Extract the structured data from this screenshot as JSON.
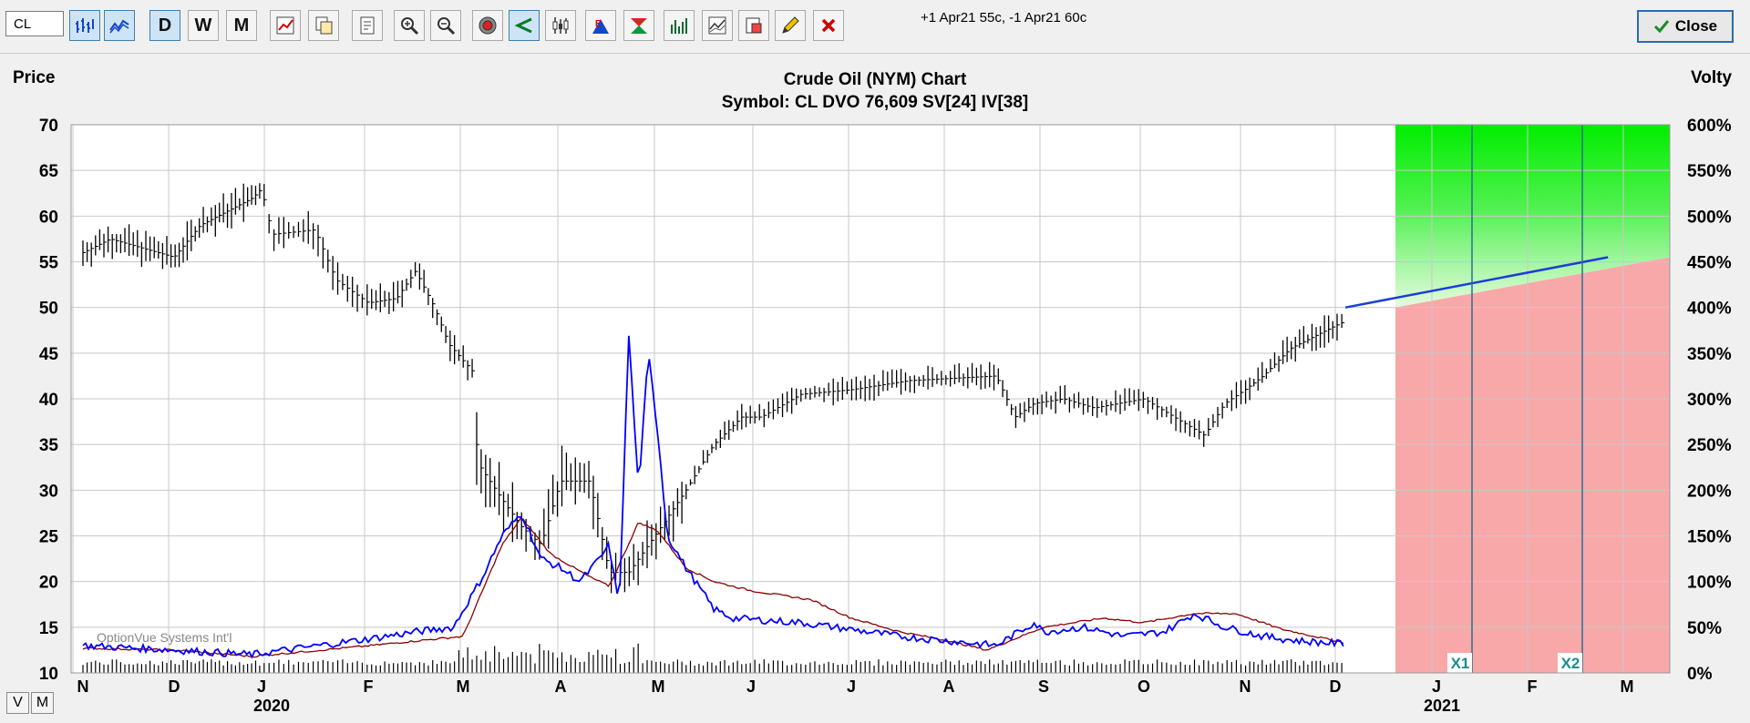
{
  "toolbar": {
    "symbol_value": "CL",
    "status_text": "+1 Apr21 55c, -1 Apr21 60c",
    "period_day": "D",
    "period_week": "W",
    "period_month": "M",
    "close_label": "Close",
    "accent": "#2a6cb3"
  },
  "bottom": {
    "v_label": "V",
    "m_label": "M"
  },
  "chart_data": {
    "type": "bar",
    "subtype": "ohlc-price-volatility",
    "title": "Crude Oil (NYM) Chart",
    "subtitle": "Symbol: CL  DVO 76,609  SV[24]  IV[38]",
    "ylabel": "Price",
    "y2label": "Volty",
    "ylim": [
      10,
      70
    ],
    "y2lim": [
      0,
      600
    ],
    "yticks": [
      "70",
      "65",
      "60",
      "55",
      "50",
      "45",
      "40",
      "35",
      "30",
      "25",
      "20",
      "15",
      "10"
    ],
    "y2ticks": [
      "600%",
      "550%",
      "500%",
      "450%",
      "400%",
      "350%",
      "300%",
      "250%",
      "200%",
      "150%",
      "100%",
      "50%",
      "0%"
    ],
    "month_labels": [
      "N",
      "D",
      "J",
      "F",
      "M",
      "A",
      "M",
      "J",
      "J",
      "A",
      "S",
      "O",
      "N",
      "D",
      "J",
      "F",
      "M"
    ],
    "year_labels": [
      "2020",
      "2021"
    ],
    "watermark": "OptionVue Systems Int'l",
    "markers": [
      "X1",
      "X2"
    ],
    "grid": true,
    "colors": {
      "price": "#000000",
      "implied_vol": "#0000ff",
      "stat_vol": "#8b0000",
      "profit_zone": "#00ee00",
      "loss_zone": "#f8a8a8",
      "projection": "#1c3ed6"
    },
    "price_anchors": [
      [
        0,
        56
      ],
      [
        0.3,
        57.5
      ],
      [
        1.0,
        55.5
      ],
      [
        1.3,
        59
      ],
      [
        1.7,
        61
      ],
      [
        1.9,
        62
      ],
      [
        2.0,
        63
      ],
      [
        2.1,
        58
      ],
      [
        2.5,
        58.5
      ],
      [
        2.7,
        53
      ],
      [
        3.0,
        50.5
      ],
      [
        3.3,
        51
      ],
      [
        3.5,
        54
      ],
      [
        3.7,
        50
      ],
      [
        3.85,
        46
      ],
      [
        4.1,
        43
      ],
      [
        4.15,
        33
      ],
      [
        4.4,
        29
      ],
      [
        4.6,
        26
      ],
      [
        4.8,
        24
      ],
      [
        5.0,
        31
      ],
      [
        5.3,
        31
      ],
      [
        5.5,
        21
      ],
      [
        5.7,
        21
      ],
      [
        5.9,
        24
      ],
      [
        6.1,
        27
      ],
      [
        6.3,
        30
      ],
      [
        6.6,
        35
      ],
      [
        6.9,
        38
      ],
      [
        7.1,
        38
      ],
      [
        7.5,
        40.5
      ],
      [
        8.0,
        41
      ],
      [
        8.6,
        42
      ],
      [
        9.5,
        42.5
      ],
      [
        9.7,
        38
      ],
      [
        9.9,
        39.5
      ],
      [
        10.2,
        40
      ],
      [
        10.5,
        39
      ],
      [
        11.0,
        40
      ],
      [
        11.6,
        36
      ],
      [
        11.8,
        39.5
      ],
      [
        12.2,
        42.5
      ],
      [
        12.5,
        45.5
      ],
      [
        13.1,
        48.5
      ]
    ],
    "stat_vol_anchors": [
      [
        0,
        27
      ],
      [
        1.0,
        25
      ],
      [
        1.9,
        18
      ],
      [
        3.5,
        35
      ],
      [
        4.0,
        40
      ],
      [
        4.4,
        140
      ],
      [
        4.6,
        170
      ],
      [
        4.9,
        130
      ],
      [
        5.3,
        105
      ],
      [
        5.5,
        95
      ],
      [
        5.8,
        165
      ],
      [
        6.0,
        155
      ],
      [
        6.3,
        115
      ],
      [
        6.6,
        100
      ],
      [
        7.0,
        90
      ],
      [
        7.3,
        85
      ],
      [
        7.6,
        80
      ],
      [
        8.0,
        60
      ],
      [
        8.5,
        45
      ],
      [
        9.0,
        35
      ],
      [
        9.4,
        25
      ],
      [
        10.0,
        50
      ],
      [
        10.6,
        60
      ],
      [
        11.0,
        55
      ],
      [
        11.5,
        65
      ],
      [
        11.9,
        65
      ],
      [
        12.4,
        48
      ],
      [
        13.1,
        33
      ]
    ],
    "implied_vol_anchors": [
      [
        0,
        30
      ],
      [
        1.0,
        25
      ],
      [
        1.9,
        20
      ],
      [
        3.5,
        45
      ],
      [
        3.9,
        50
      ],
      [
        4.2,
        105
      ],
      [
        4.4,
        150
      ],
      [
        4.6,
        175
      ],
      [
        4.8,
        125
      ],
      [
        5.0,
        115
      ],
      [
        5.2,
        100
      ],
      [
        5.4,
        125
      ],
      [
        5.5,
        140
      ],
      [
        5.6,
        70
      ],
      [
        5.7,
        370
      ],
      [
        5.8,
        200
      ],
      [
        5.9,
        350
      ],
      [
        6.0,
        260
      ],
      [
        6.1,
        150
      ],
      [
        6.3,
        115
      ],
      [
        6.6,
        70
      ],
      [
        6.8,
        60
      ],
      [
        7.5,
        55
      ],
      [
        8.5,
        40
      ],
      [
        9.5,
        30
      ],
      [
        9.9,
        55
      ],
      [
        10.0,
        45
      ],
      [
        10.4,
        50
      ],
      [
        10.8,
        40
      ],
      [
        11.2,
        45
      ],
      [
        11.5,
        65
      ],
      [
        11.8,
        50
      ],
      [
        12.2,
        40
      ],
      [
        12.6,
        35
      ],
      [
        13.1,
        32
      ]
    ],
    "projection": {
      "start": [
        13.1,
        400
      ],
      "end": [
        15.8,
        455
      ]
    }
  }
}
